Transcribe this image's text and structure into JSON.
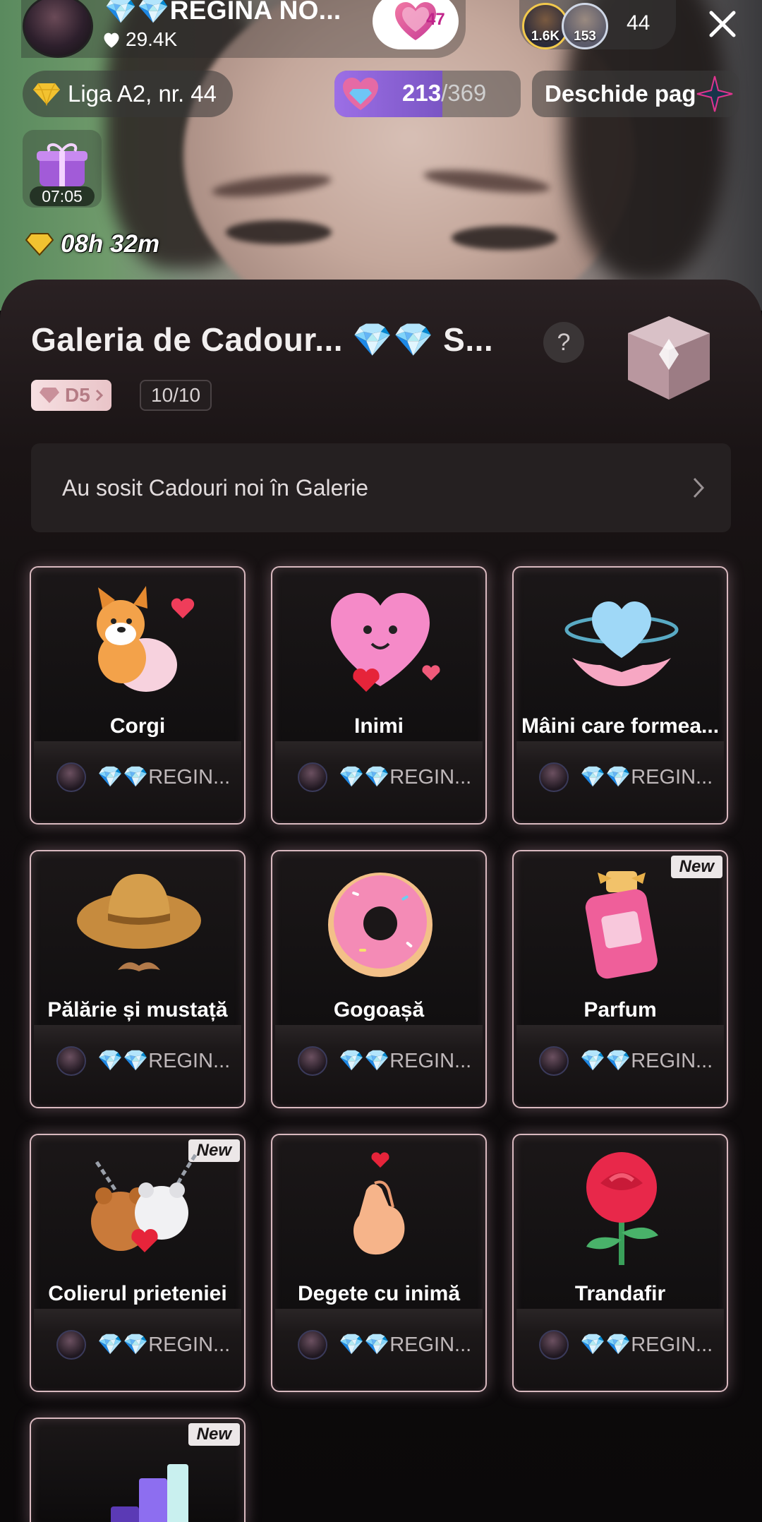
{
  "header": {
    "host_name": "💎💎REGINA NO...",
    "host_likes": "29.4K",
    "follow_count": "47",
    "viewers": [
      {
        "count": "1.6K"
      },
      {
        "count": "153"
      }
    ],
    "viewer_total": "44"
  },
  "live_bar": {
    "league": "Liga A2, nr. 44",
    "progress_current": "213",
    "progress_total": "/369",
    "progress_fraction": 0.58,
    "open_label": "Deschide pag",
    "timer": "07:05",
    "countdown": "08h 32m"
  },
  "gallery": {
    "title": "Galeria de Cadour... 💎💎 S...",
    "help": "?",
    "level": "D5",
    "count": "10/10",
    "banner": "Au sosit Cadouri noi în Galerie",
    "new_label": "New",
    "gifts": [
      {
        "name": "Corgi",
        "owner": "💎💎REGIN...",
        "icon": "corgi-icon",
        "is_new": false
      },
      {
        "name": "Inimi",
        "owner": "💎💎REGIN...",
        "icon": "hearts-icon",
        "is_new": false
      },
      {
        "name": "Mâini care formea...",
        "owner": "💎💎REGIN...",
        "icon": "hands-heart-icon",
        "is_new": false
      },
      {
        "name": "Pălărie și mustață",
        "owner": "💎💎REGIN...",
        "icon": "hat-mustache-icon",
        "is_new": false
      },
      {
        "name": "Gogoașă",
        "owner": "💎💎REGIN...",
        "icon": "donut-icon",
        "is_new": false
      },
      {
        "name": "Parfum",
        "owner": "💎💎REGIN...",
        "icon": "perfume-icon",
        "is_new": true
      },
      {
        "name": "Colierul prieteniei",
        "owner": "💎💎REGIN...",
        "icon": "bears-necklace-icon",
        "is_new": true
      },
      {
        "name": "Degete cu inimă",
        "owner": "💎💎REGIN...",
        "icon": "finger-heart-icon",
        "is_new": false
      },
      {
        "name": "Trandafir",
        "owner": "💎💎REGIN...",
        "icon": "rose-icon",
        "is_new": false
      },
      {
        "name": "",
        "owner": "",
        "icon": "chart-blocks-icon",
        "is_new": true
      }
    ]
  },
  "colors": {
    "accent_pink": "#e0348f",
    "progress_purple": "#9c6fe6",
    "card_border": "#d9b9bf",
    "gold": "#f2c230"
  }
}
